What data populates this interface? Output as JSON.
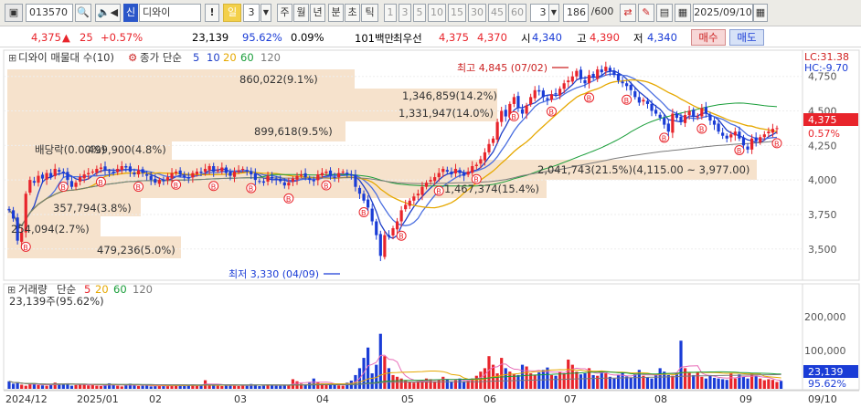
{
  "toolbar": {
    "code": "013570",
    "stock_name": "디와이",
    "ask_badge": "신",
    "alert": "!",
    "period": "일",
    "period_n": "3",
    "periods": [
      "주",
      "월",
      "년",
      "분",
      "초",
      "틱"
    ],
    "minutes": [
      "1",
      "3",
      "5",
      "10",
      "15",
      "30",
      "45",
      "60"
    ],
    "select_n": "3",
    "count": "186",
    "count_total": "/600",
    "date": "2025/09/10",
    "icons": [
      "symbol-search-icon",
      "magnifier-icon",
      "speaker-icon",
      "alert-icon",
      "chart-type-icon",
      "tool-icon",
      "save-icon",
      "print-icon",
      "calendar-icon"
    ]
  },
  "quote": {
    "price": "4,375",
    "arrow": "▲",
    "change": "25",
    "change_pct": "+0.57%",
    "volume": "23,139",
    "vol_ratio": "95.62%",
    "turnover_pct": "0.09%",
    "label_101": "101백만",
    "label_best": "최우선",
    "best_ask": "4,375",
    "best_bid": "4,370",
    "open_label": "시",
    "open": "4,340",
    "high_label": "고",
    "high": "4,390",
    "low_label": "저",
    "low": "4,340",
    "buy_label": "매수",
    "sell_label": "매도",
    "up_color": "#e8242b",
    "down_color": "#1a3cd6"
  },
  "price_panel": {
    "title": "디와이 매물대 수(10)",
    "ma_label": "종가 단순",
    "ma_periods": [
      "5",
      "10",
      "20",
      "60",
      "120"
    ],
    "ma_colors": [
      "#1f3fc8",
      "#f0b000",
      "#e6a800",
      "#1a9e3a",
      "#7b7b7b"
    ],
    "lc": "LC:31.38",
    "hc": "HC:-9.70",
    "last_price": "4,375",
    "last_pct": "0.57%",
    "ticks": [
      "4,750",
      "4,500",
      "4,250",
      "4,000",
      "3,750",
      "3,500"
    ],
    "volume_profile": [
      "860,022(9.1%)",
      "1,346,859(14.2%)",
      "1,331,947(14.0%)",
      "899,618(9.5%)",
      "배당락(0.00%)",
      "499,900(4.8%)",
      "2,041,743(21.5%)(4,115.00 ~ 3,977.00)",
      "1,467,374(15.4%)",
      "357,794(3.8%)",
      "254,094(2.7%)",
      "479,236(5.0%)"
    ],
    "high_note": "최고 4,845 (07/02)",
    "low_note": "최저 3,330 (04/09)"
  },
  "volume_panel": {
    "title": "거래량",
    "ma_label": "단순",
    "ma_periods": [
      "5",
      "20",
      "60",
      "120"
    ],
    "info": "23,139주(95.62%)",
    "ticks": [
      "200,000",
      "100,000"
    ],
    "last_volume": "23,139",
    "last_pct": "95.62%"
  },
  "xaxis": [
    "2024/12",
    "2025/01",
    "02",
    "03",
    "04",
    "05",
    "06",
    "07",
    "08",
    "09",
    "09/10"
  ],
  "chart_data": {
    "type": "candlestick",
    "xlabel": "",
    "ylabel": "",
    "ylim": [
      3330,
      4845
    ],
    "closes": [
      3780,
      3720,
      3560,
      3620,
      3900,
      4000,
      3980,
      4030,
      4010,
      4050,
      4020,
      4080,
      4060,
      4050,
      4000,
      3950,
      3980,
      4020,
      4040,
      4050,
      4060,
      4080,
      4090,
      4070,
      4060,
      4050,
      4080,
      4100,
      4090,
      4060,
      4040,
      4070,
      4050,
      4030,
      4000,
      3980,
      4000,
      3990,
      4020,
      4050,
      4060,
      4040,
      4020,
      4010,
      4050,
      4060,
      4050,
      4080,
      4100,
      4060,
      4070,
      4090,
      4050,
      4030,
      4060,
      4070,
      4080,
      4060,
      4040,
      4000,
      3990,
      3980,
      4030,
      4010,
      4000,
      3990,
      3960,
      3980,
      4010,
      4030,
      4040,
      4020,
      4000,
      3990,
      4040,
      4050,
      4060,
      4030,
      4020,
      4050,
      4060,
      4040,
      4030,
      3950,
      3900,
      3850,
      3800,
      3700,
      3600,
      3450,
      3600,
      3590,
      3650,
      3700,
      3780,
      3820,
      3850,
      3880,
      3900,
      3950,
      3980,
      4000,
      4020,
      4050,
      4080,
      4060,
      4040,
      4080,
      4050,
      4030,
      4060,
      4100,
      4110,
      4150,
      4200,
      4260,
      4300,
      4420,
      4500,
      4460,
      4550,
      4600,
      4520,
      4480,
      4540,
      4600,
      4650,
      4640,
      4600,
      4580,
      4620,
      4620,
      4660,
      4700,
      4720,
      4750,
      4790,
      4730,
      4700,
      4760,
      4740,
      4800,
      4780,
      4820,
      4790,
      4760,
      4720,
      4700,
      4680,
      4650,
      4600,
      4560,
      4580,
      4550,
      4500,
      4480,
      4450,
      4400,
      4350,
      4480,
      4450,
      4420,
      4470,
      4500,
      4460,
      4460,
      4520,
      4480,
      4430,
      4400,
      4350,
      4320,
      4300,
      4330,
      4350,
      4300,
      4250,
      4220,
      4300,
      4280,
      4310,
      4330,
      4350,
      4370,
      4375
    ],
    "volumes": [
      22000,
      15000,
      18000,
      12000,
      9000,
      14000,
      16000,
      11000,
      10000,
      9000,
      12000,
      18000,
      15000,
      13000,
      16000,
      9000,
      11000,
      13000,
      14000,
      10000,
      12000,
      9000,
      8000,
      12000,
      16000,
      11000,
      9000,
      7000,
      12000,
      15000,
      10000,
      8000,
      9000,
      11000,
      7000,
      8000,
      10000,
      9000,
      8000,
      10000,
      12000,
      9000,
      8000,
      10000,
      13000,
      9000,
      12000,
      25000,
      11000,
      10000,
      9000,
      8000,
      11000,
      13000,
      9000,
      8000,
      10000,
      9000,
      14000,
      12000,
      8000,
      9000,
      13000,
      11000,
      10000,
      9000,
      10000,
      12000,
      28000,
      22000,
      15000,
      12000,
      18000,
      30000,
      20000,
      16000,
      14000,
      11000,
      12000,
      10000,
      9000,
      18000,
      24000,
      40000,
      60000,
      90000,
      120000,
      45000,
      70000,
      160000,
      95000,
      60000,
      40000,
      35000,
      30000,
      25000,
      20000,
      18000,
      22000,
      24000,
      30000,
      28000,
      22000,
      26000,
      35000,
      28000,
      20000,
      25000,
      30000,
      22000,
      24000,
      30000,
      38000,
      50000,
      60000,
      95000,
      70000,
      45000,
      90000,
      60000,
      50000,
      42000,
      40000,
      70000,
      65000,
      45000,
      40000,
      48000,
      55000,
      62000,
      40000,
      38000,
      50000,
      45000,
      85000,
      70000,
      50000,
      42000,
      45000,
      60000,
      40000,
      38000,
      52000,
      45000,
      35000,
      30000,
      40000,
      48000,
      36000,
      32000,
      44000,
      55000,
      38000,
      34000,
      30000,
      42000,
      60000,
      50000,
      40000,
      38000,
      45000,
      140000,
      60000,
      48000,
      40000,
      48000,
      35000,
      30000,
      40000,
      32000,
      30000,
      28000,
      26000,
      45000,
      30000,
      42000,
      35000,
      30000,
      45000,
      38000,
      30000,
      25000,
      28000,
      26000,
      20000,
      23139
    ]
  }
}
